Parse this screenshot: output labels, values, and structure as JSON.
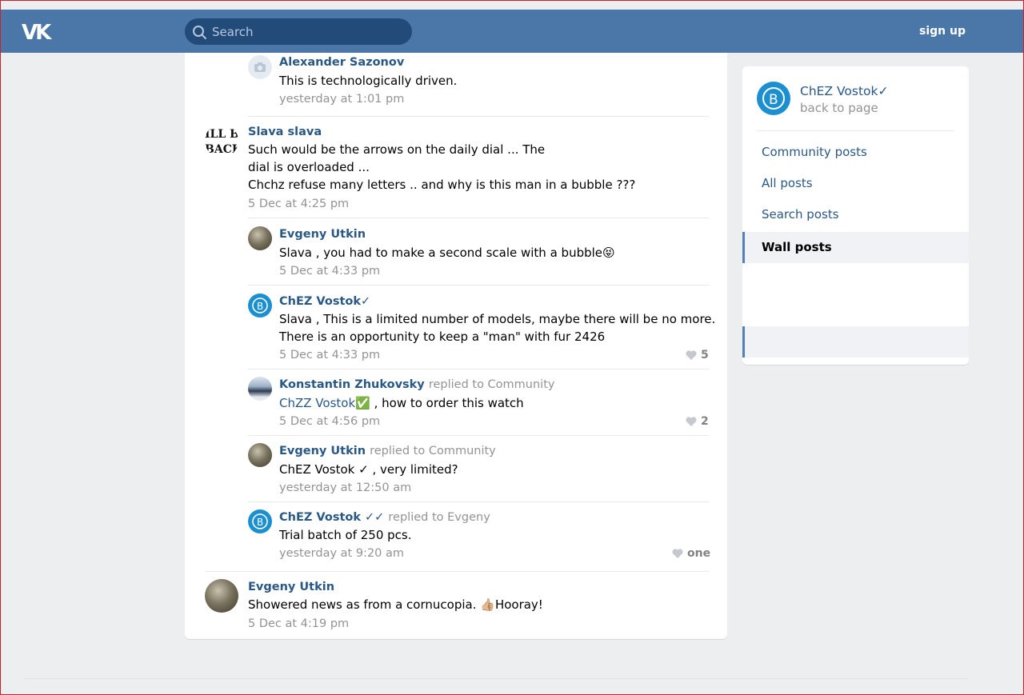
{
  "header": {
    "search_placeholder": "Search",
    "signup_label": "sign up",
    "accent_color": "#4a76a8"
  },
  "comments": [
    {
      "author": "Alexander Sazonov",
      "lines": [
        "This is technologically driven."
      ],
      "date": "yesterday at 1:01 pm",
      "avatar": "camera-icon"
    },
    {
      "author": "Slava slava",
      "lines": [
        "Such would be the arrows on the daily dial ... The",
        "dial is overloaded ...",
        "Chchz refuse many letters .. and why is this man in a bubble ???"
      ],
      "date": "5 Dec at 4:25 pm",
      "avatar_text": [
        "ILL BE",
        "BACK"
      ]
    },
    {
      "author": "Evgeny Utkin",
      "lines": [
        "Slava , you had to make a second scale with a bubble"
      ],
      "date": "5 Dec at 4:33 pm",
      "emoji": "😝"
    },
    {
      "author": "ChEZ Vostok✓",
      "lines": [
        "Slava , This is a limited number of models, maybe there will be no more.",
        "There is an opportunity to keep a \"man\" with fur 2426"
      ],
      "date": "5 Dec at 4:33 pm",
      "likes": "5"
    },
    {
      "author": "Konstantin Zhukovsky",
      "reply": "replied to Community",
      "link": "ChZZ Vostok",
      "emoji": "✅",
      "rest": " , how to order this watch",
      "date": "5 Dec at 4:56 pm",
      "likes": "2"
    },
    {
      "author": "Evgeny Utkin",
      "reply": "replied to Community",
      "lines": [
        "ChEZ Vostok ✓ , very limited?"
      ],
      "date": "yesterday at 12:50 am"
    },
    {
      "author": "ChEZ Vostok ✓✓",
      "reply": "replied to Evgeny",
      "lines": [
        "Trial batch of 250 pcs."
      ],
      "date": "yesterday at 9:20 am",
      "likes": "one"
    },
    {
      "author": "Evgeny Utkin",
      "text_before": "Showered news as from a cornucopia. ",
      "emoji": "👍🏼",
      "text_after": "Hooray!",
      "date": "5 Dec at 4:19 pm"
    }
  ],
  "sidebar": {
    "community_name": "ChEZ Vostok✓",
    "back_label": "back to page",
    "menu": [
      "Community posts",
      "All posts",
      "Search posts",
      "Wall posts"
    ]
  }
}
